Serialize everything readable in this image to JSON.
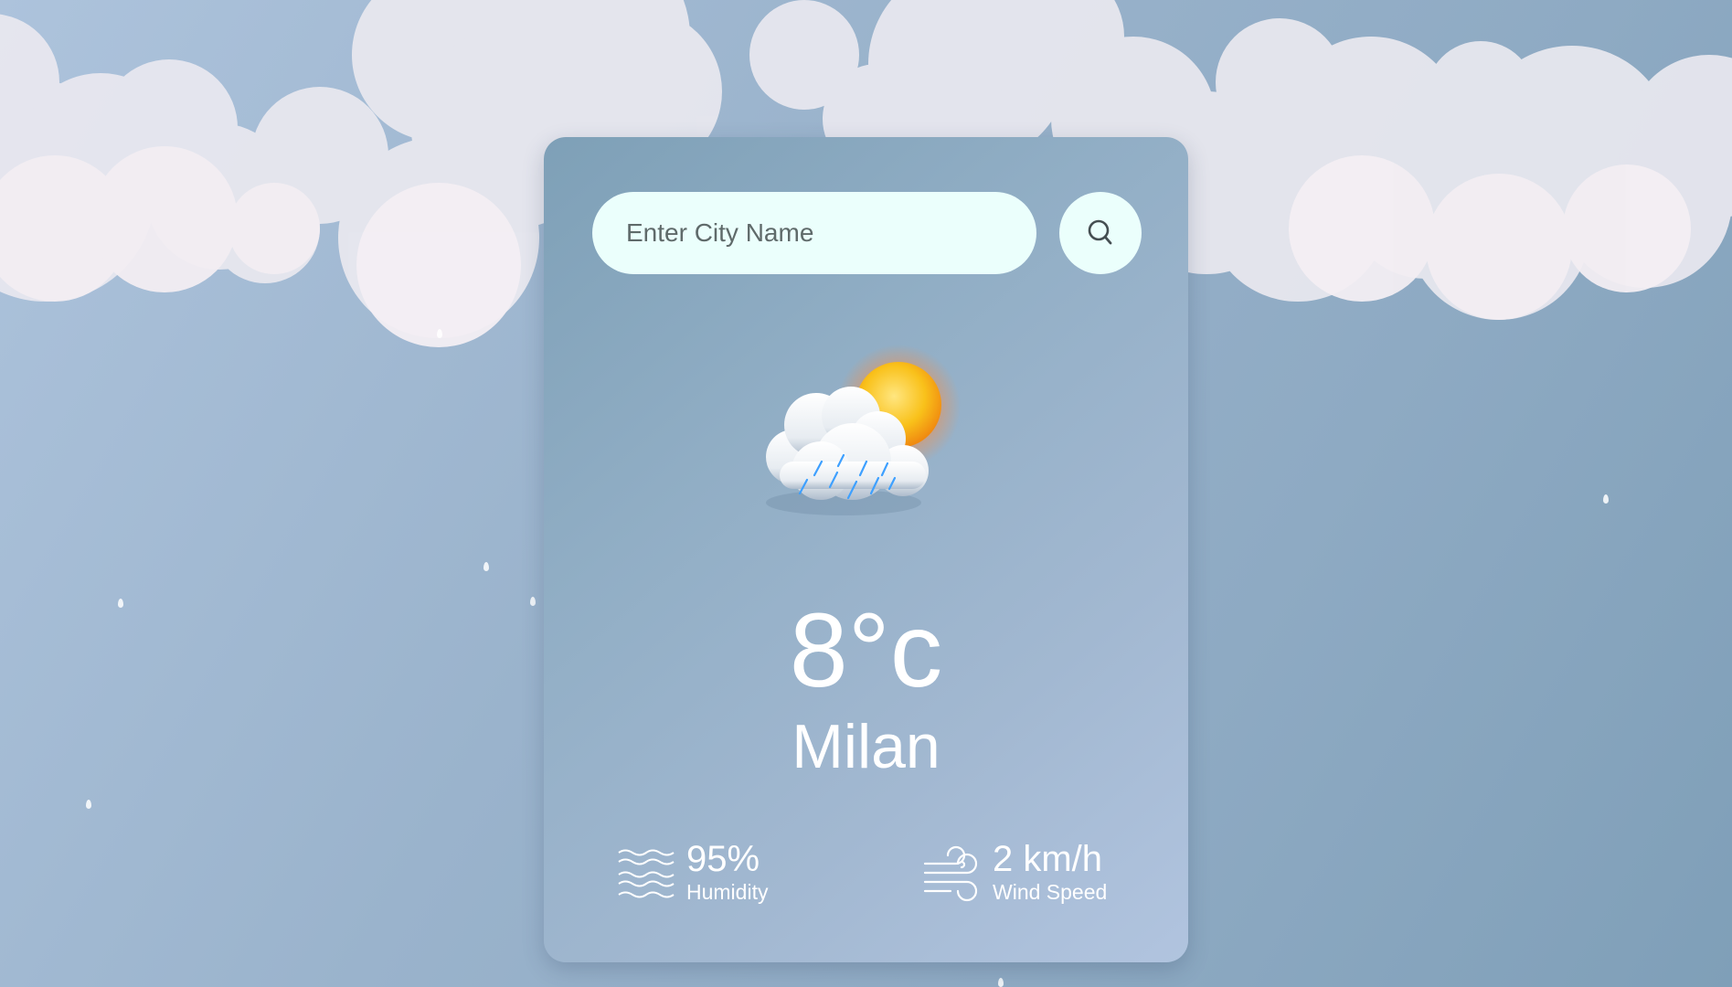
{
  "search": {
    "placeholder": "Enter City Name",
    "value": ""
  },
  "icons": {
    "search": "search-icon",
    "weather": "cloud-sun-rain-icon",
    "humidity": "humidity-waves-icon",
    "wind": "wind-icon"
  },
  "weather": {
    "temperature": "8°c",
    "city": "Milan",
    "humidity_value": "95%",
    "humidity_label": "Humidity",
    "wind_value": "2 km/h",
    "wind_label": "Wind Speed"
  },
  "colors": {
    "input_background": "#ebfffc",
    "text": "#ffffff",
    "sun": "#f7c21c"
  }
}
